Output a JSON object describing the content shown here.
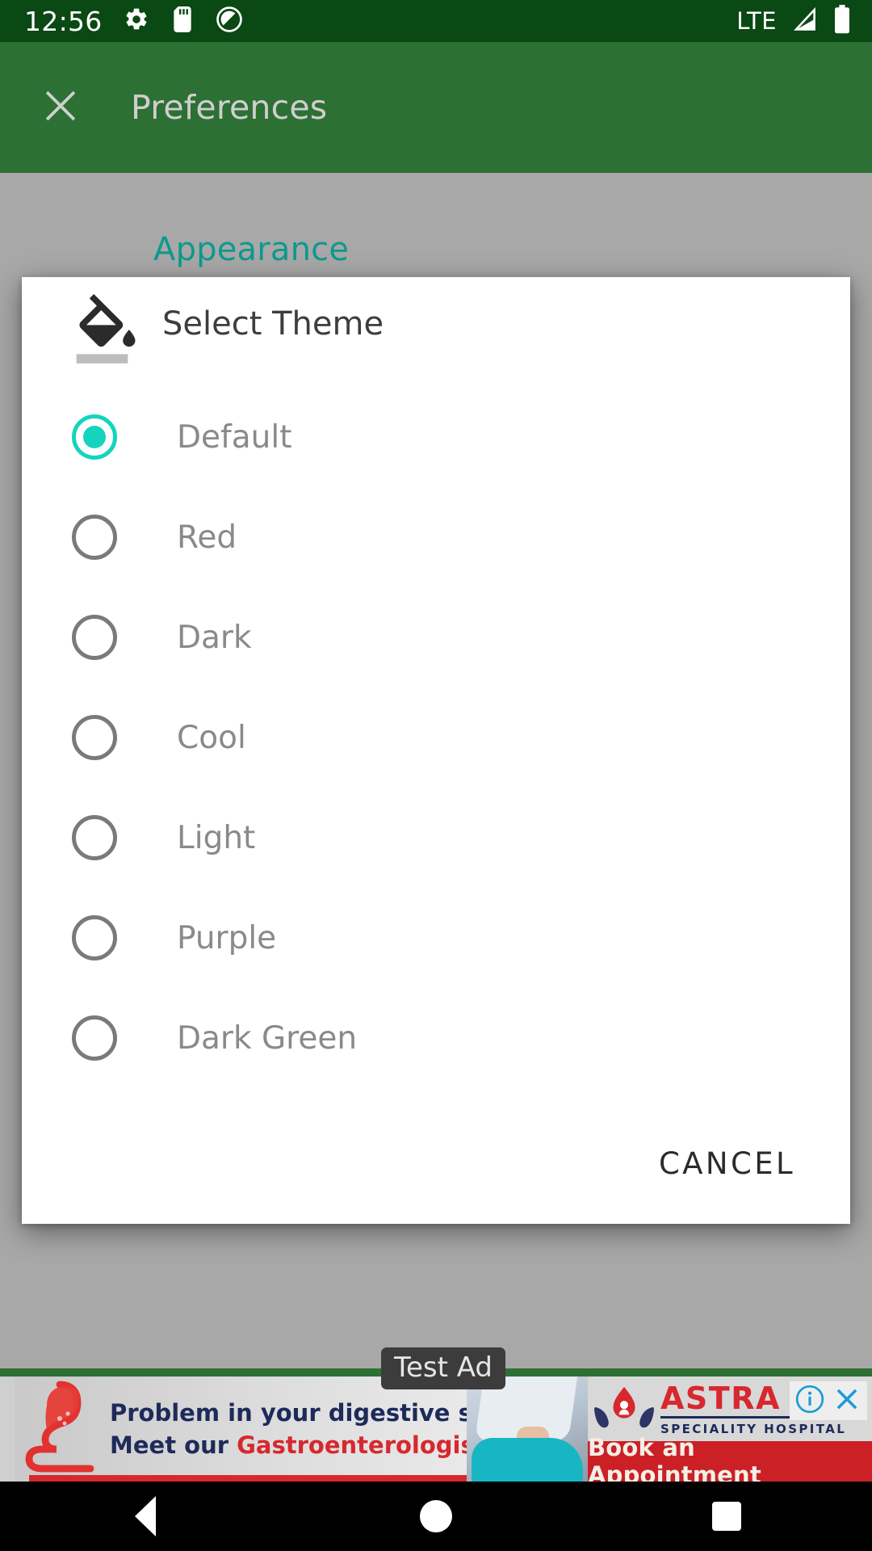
{
  "statusbar": {
    "time": "12:56",
    "network": "LTE",
    "icons": [
      "gear-icon",
      "sd-card-icon",
      "do-not-disturb-icon",
      "signal-icon",
      "battery-icon"
    ]
  },
  "appbar": {
    "title": "Preferences",
    "close_icon": "close-icon"
  },
  "page": {
    "section_header": "Appearance",
    "section_header_color": "#0d9a8d"
  },
  "dialog": {
    "title": "Select Theme",
    "icon": "format-color-fill-icon",
    "selected_value": "Default",
    "accent_color": "#15d4bd",
    "options": [
      {
        "label": "Default",
        "selected": true
      },
      {
        "label": "Red",
        "selected": false
      },
      {
        "label": "Dark",
        "selected": false
      },
      {
        "label": "Cool",
        "selected": false
      },
      {
        "label": "Light",
        "selected": false
      },
      {
        "label": "Purple",
        "selected": false
      },
      {
        "label": "Dark Green",
        "selected": false
      }
    ],
    "cancel_label": "CANCEL"
  },
  "ad": {
    "badge": "Test Ad",
    "line1": "Problem in your digestive sy",
    "line2_prefix": "Meet our ",
    "line2_accent": "Gastroenterologist:)",
    "brand": "ASTRA",
    "brand_sub": "SPECIALITY HOSPITAL",
    "cta": "Book an Appointment",
    "info_icon": "info-icon",
    "close_icon": "close-icon"
  },
  "navbar": {
    "back": "back-icon",
    "home": "home-icon",
    "recents": "recents-icon"
  }
}
